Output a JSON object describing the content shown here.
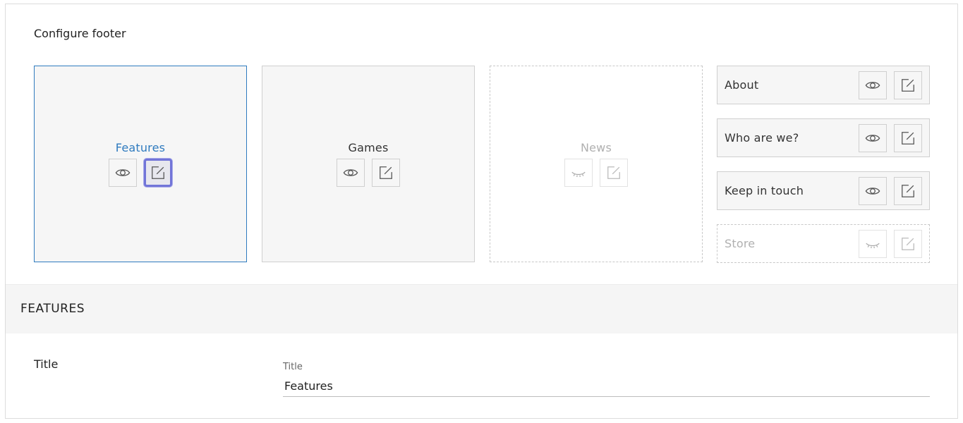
{
  "heading": "Configure footer",
  "cards": [
    {
      "label": "Features",
      "state": "selected",
      "visibility_icon": "eye-open-icon",
      "edit_icon": "edit-icon"
    },
    {
      "label": "Games",
      "state": "normal",
      "visibility_icon": "eye-open-icon",
      "edit_icon": "edit-icon"
    },
    {
      "label": "News",
      "state": "hidden",
      "visibility_icon": "eye-closed-icon",
      "edit_icon": "edit-icon"
    }
  ],
  "list_items": [
    {
      "label": "About",
      "state": "normal",
      "visibility_icon": "eye-open-icon",
      "edit_icon": "edit-icon"
    },
    {
      "label": "Who are we?",
      "state": "normal",
      "visibility_icon": "eye-open-icon",
      "edit_icon": "edit-icon"
    },
    {
      "label": "Keep in touch",
      "state": "normal",
      "visibility_icon": "eye-open-icon",
      "edit_icon": "edit-icon"
    },
    {
      "label": "Store",
      "state": "hidden",
      "visibility_icon": "eye-closed-icon",
      "edit_icon": "edit-icon"
    }
  ],
  "section": {
    "title": "FEATURES",
    "field_label": "Title",
    "input_caption": "Title",
    "input_value": "Features"
  },
  "colors": {
    "accent": "#2f7bbf",
    "focus_ring": "#7275d8",
    "card_bg": "#f6f6f6",
    "muted_text": "#b0b0b0"
  }
}
